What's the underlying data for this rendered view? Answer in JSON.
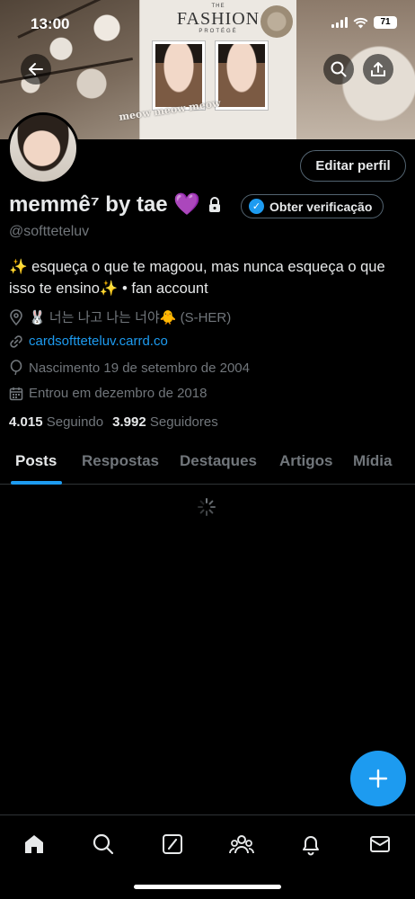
{
  "status_bar": {
    "time": "13:00",
    "battery": "71"
  },
  "banner": {
    "magazine_the": "THE",
    "magazine_title": "FASHION",
    "magazine_subtitle": "PROTÉGÉ",
    "sticker_text": "meow meow meow"
  },
  "header": {
    "back_icon": "arrow-left-icon",
    "search_icon": "search-icon",
    "share_icon": "share-icon"
  },
  "profile": {
    "edit_label": "Editar perfil",
    "display_name": "memmê⁷ by tae 💜",
    "verify_label": "Obter verificação",
    "handle": "@softteteluv",
    "bio": "✨ esqueça o que te magoou, mas nunca esqueça o que isso te ensino✨ • fan account",
    "location": "🐰 너는 나고 나는 너야🐥 (S-HER)",
    "website": "cardsoftteteluv.carrd.co",
    "birth": "Nascimento 19 de setembro de 2004",
    "joined": "Entrou em dezembro de 2018",
    "following_count": "4.015",
    "following_label": "Seguindo",
    "followers_count": "3.992",
    "followers_label": "Seguidores"
  },
  "tabs": [
    {
      "label": "Posts"
    },
    {
      "label": "Respostas"
    },
    {
      "label": "Destaques"
    },
    {
      "label": "Artigos"
    },
    {
      "label": "Mídia"
    }
  ],
  "colors": {
    "accent": "#1d9bf0",
    "background": "#000000",
    "muted": "#71767b",
    "text": "#e7e9ea"
  }
}
